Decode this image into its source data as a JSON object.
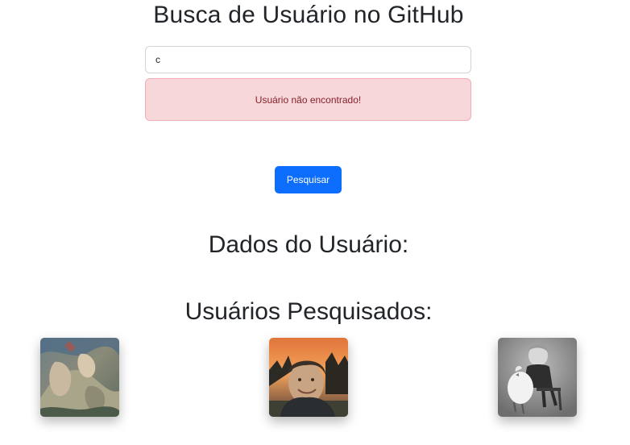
{
  "header": {
    "title": "Busca de Usuário no GitHub"
  },
  "search": {
    "value": "c",
    "placeholder": ""
  },
  "alert": {
    "message": "Usuário não encontrado!",
    "background": "#f8d7da",
    "text_color": "#842029"
  },
  "actions": {
    "search_label": "Pesquisar",
    "accent": "#0d6efd"
  },
  "sections": {
    "user_data_heading": "Dados do Usuário:",
    "searched_users_heading": "Usuários Pesquisados:"
  },
  "searched_users": [
    {
      "avatar_desc": "painting-avatar"
    },
    {
      "avatar_desc": "photo-avatar-sunset"
    },
    {
      "avatar_desc": "bw-photo-avatar"
    }
  ]
}
